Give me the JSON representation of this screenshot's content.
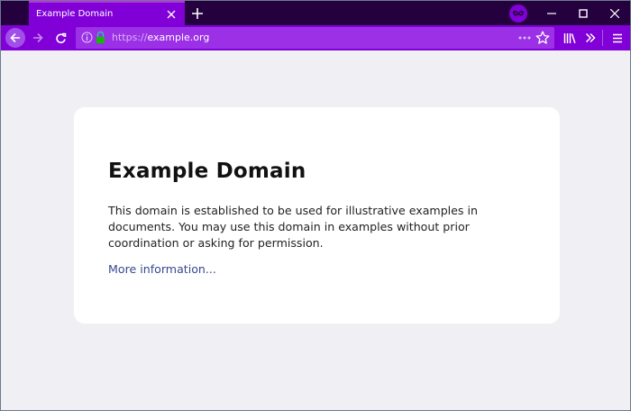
{
  "window": {
    "tab": {
      "title": "Example Domain"
    },
    "icons": {
      "tab_close": "close-icon",
      "new_tab": "plus-icon",
      "private_browsing": "mask-icon",
      "minimize": "minimize-icon",
      "maximize": "maximize-icon",
      "close": "close-icon"
    }
  },
  "navbar": {
    "url_protocol": "https://",
    "url_host": "example.org",
    "icons": [
      "back-arrow-icon",
      "forward-arrow-icon",
      "reload-icon",
      "info-icon",
      "lock-icon",
      "more-dots-icon",
      "star-icon",
      "library-icon",
      "overflow-chevron-icon",
      "hamburger-menu-icon"
    ]
  },
  "page": {
    "heading": "Example Domain",
    "description": "This domain is established to be used for illustrative examples in documents. You may use this domain in examples without prior coordination or asking for permission.",
    "link_text": "More information..."
  },
  "colors": {
    "titlebar": "#25003e",
    "tab_active": "#8000d7",
    "navbar": "#8000d7",
    "urlbar": "#9b30e6",
    "page_bg": "#f0f0f4",
    "link": "#38488f"
  }
}
